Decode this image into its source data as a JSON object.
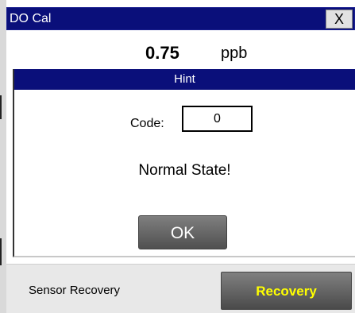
{
  "window": {
    "title": "DO Cal",
    "close_label": "X"
  },
  "reading": {
    "value": "0.75",
    "unit": "ppb"
  },
  "dialog": {
    "title": "Hint",
    "code_label": "Code:",
    "code_value": "0",
    "message": "Normal State!",
    "ok_label": "OK"
  },
  "footer": {
    "label": "Sensor Recovery",
    "button_label": "Recovery"
  },
  "colors": {
    "title_bar": "#0a0f7a",
    "recovery_text": "#ffff00"
  }
}
